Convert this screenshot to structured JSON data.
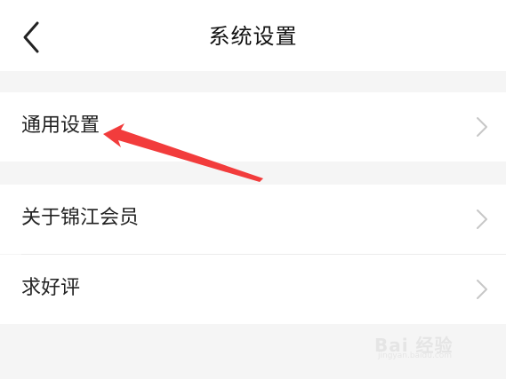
{
  "header": {
    "title": "系统设置",
    "back_icon": "chevron-left-icon"
  },
  "menu": {
    "general_settings": "通用设置",
    "about_member": "关于锦江会员",
    "rate_us": "求好评"
  },
  "watermark": {
    "brand": "Bai 经验",
    "url": "jingyan.baidu.com"
  },
  "colors": {
    "background": "#f5f5f5",
    "row": "#ffffff",
    "arrow": "#f23c3c",
    "chevron": "#c7c7c7"
  },
  "icons": {
    "row_chevron": "chevron-right-icon"
  }
}
